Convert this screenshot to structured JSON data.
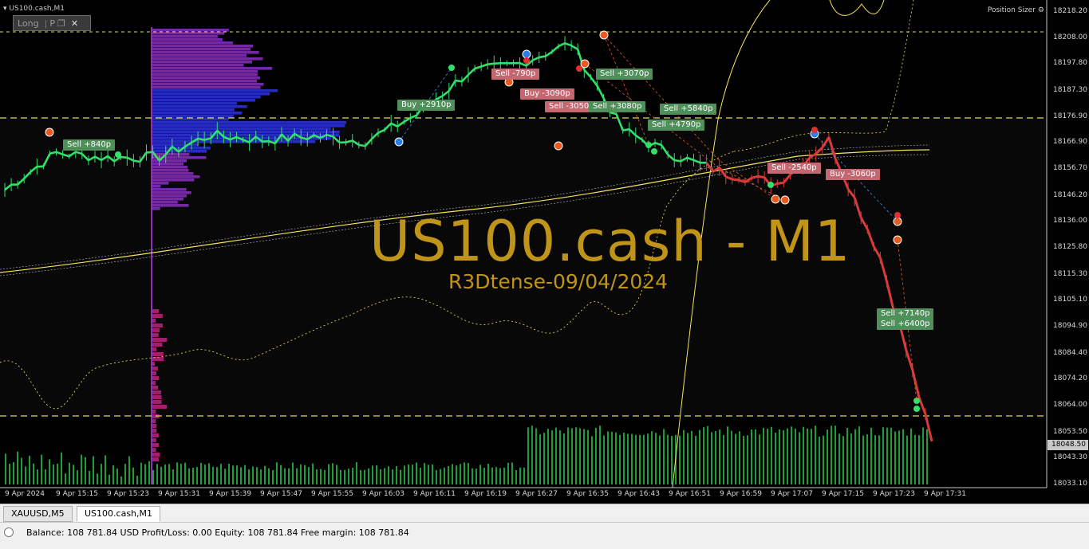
{
  "window": {
    "title": "US100.cash,M1",
    "position_sizer_label": "Position Sizer",
    "trade_panel": {
      "label": "Long",
      "p": "P"
    }
  },
  "watermark": {
    "title": "US100.cash - M1",
    "subtitle": "R3Dtense-09/04/2024"
  },
  "price_axis": {
    "labels": [
      "18218.20",
      "18208.00",
      "18197.80",
      "18187.30",
      "18176.90",
      "18166.90",
      "18156.70",
      "18146.20",
      "18136.00",
      "18125.80",
      "18115.30",
      "18105.10",
      "18094.90",
      "18084.40",
      "18074.20",
      "18064.00",
      "18053.50",
      "18043.30",
      "18033.10"
    ],
    "current_price": "18048.50"
  },
  "time_axis": {
    "labels": [
      "9 Apr 2024",
      "9 Apr 15:15",
      "9 Apr 15:23",
      "9 Apr 15:31",
      "9 Apr 15:39",
      "9 Apr 15:47",
      "9 Apr 15:55",
      "9 Apr 16:03",
      "9 Apr 16:11",
      "9 Apr 16:19",
      "9 Apr 16:27",
      "9 Apr 16:35",
      "9 Apr 16:43",
      "9 Apr 16:51",
      "9 Apr 16:59",
      "9 Apr 17:07",
      "9 Apr 17:15",
      "9 Apr 17:23",
      "9 Apr 17:31"
    ]
  },
  "trade_tags": [
    {
      "text": "Sell +840p",
      "kind": "win"
    },
    {
      "text": "Buy +2910p",
      "kind": "win"
    },
    {
      "text": "Sell -790p",
      "kind": "loss"
    },
    {
      "text": "Buy -3090p",
      "kind": "loss"
    },
    {
      "text": "Sell -3050p",
      "kind": "loss"
    },
    {
      "text": "Sell +3070p",
      "kind": "win"
    },
    {
      "text": "Sell +3080p",
      "kind": "win"
    },
    {
      "text": "Sell +5840p",
      "kind": "win"
    },
    {
      "text": "Sell +4790p",
      "kind": "win"
    },
    {
      "text": "Sell -2540p",
      "kind": "loss"
    },
    {
      "text": "Buy -3060p",
      "kind": "loss"
    },
    {
      "text": "Sell +7140p",
      "kind": "win"
    },
    {
      "text": "Sell +6400p",
      "kind": "win"
    }
  ],
  "tabs": [
    {
      "label": "XAUUSD,M5",
      "active": false
    },
    {
      "label": "US100.cash,M1",
      "active": true
    }
  ],
  "status": {
    "text": "Balance: 108 781.84 USD  Profit/Loss: 0.00  Equity: 108 781.84  Free margin: 108 781.84"
  },
  "colors": {
    "background": "#000000",
    "chart_bg_band": "#0a0a0a",
    "price_up": "#33e06a",
    "price_down": "#d83a3a",
    "ma_line": "#f5e45a",
    "guide_line": "#e8d85a",
    "volume": "#1f9d3a",
    "profile_blue": "#2a34d8",
    "profile_purple": "#8a2fbf",
    "profile_magenta": "#a0206e",
    "watermark": "#c09418"
  },
  "chart_data": {
    "type": "line",
    "symbol": "US100.cash",
    "timeframe": "M1",
    "x": [
      "9 Apr 2024",
      "9 Apr 15:15",
      "9 Apr 15:23",
      "9 Apr 15:31",
      "9 Apr 15:39",
      "9 Apr 15:47",
      "9 Apr 15:55",
      "9 Apr 16:03",
      "9 Apr 16:11",
      "9 Apr 16:19",
      "9 Apr 16:27",
      "9 Apr 16:35",
      "9 Apr 16:43",
      "9 Apr 16:51",
      "9 Apr 16:59",
      "9 Apr 17:07",
      "9 Apr 17:15",
      "9 Apr 17:23",
      "9 Apr 17:31"
    ],
    "series": [
      {
        "values": [
          18148.5,
          18163.0,
          18161.0,
          18161.5,
          18170.0,
          18168.0,
          18169.5,
          18167.5,
          18178.0,
          18194.5,
          18198.0,
          18206.0,
          18172.0,
          18162.0,
          18155.0,
          18151.0,
          18168.0,
          18122.0,
          18050.0
        ]
      }
    ],
    "ylim": [
      18033.1,
      18218.2
    ],
    "grid": false
  }
}
